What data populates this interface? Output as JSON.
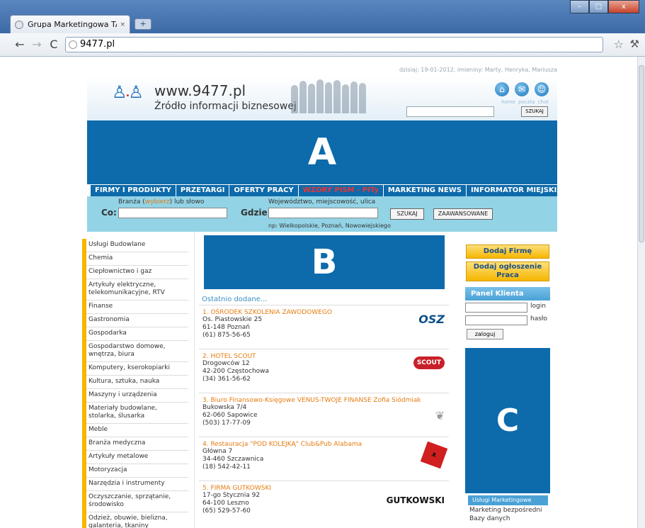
{
  "browser": {
    "tab_title": "Grupa Marketingowa TAI - ...",
    "tab_close": "×",
    "new_tab": "+",
    "url": "9477.pl",
    "win_min": "–",
    "win_max": "□",
    "win_close": "x"
  },
  "header": {
    "date_line": "dzisiaj: 19-01-2012,  imieniny: Marty, Henryka, Mariusza",
    "site_url": "www.9477.pl",
    "tagline": "Źródło informacji biznesowej",
    "icon_labels": "home poczta chat",
    "search_button": "SZUKAJ"
  },
  "banners": {
    "a": "A",
    "b": "B",
    "c": "C"
  },
  "nav": [
    "FIRMY I PRODUKTY",
    "PRZETARGI",
    "OFERTY PRACY",
    "WZORY PISM - PITy",
    "MARKETING NEWS",
    "INFORMATOR MIEJSKI"
  ],
  "search": {
    "hint_pre": "Branża (",
    "hint_link": "wybierz",
    "hint_post": ") lub słowo",
    "co_label": "Co:",
    "gdzie_label": "Gdzie:",
    "gdzie_hint": "Województwo, miejscowość, ulica",
    "example": "np: Wielkopolskie, Poznań, Nowowiejskiego",
    "search_btn": "SZUKAJ",
    "advanced_btn": "ZAAWANSOWANE"
  },
  "categories": [
    "Usługi Budowlane",
    "Chemia",
    "Ciepłownictwo i gaz",
    "Artykuły elektryczne, telekomunikacyjne, RTV",
    "Finanse",
    "Gastronomia",
    "Gospodarka",
    "Gospodarstwo domowe, wnętrza, biura",
    "Komputery, kserokopiarki",
    "Kultura, sztuka, nauka",
    "Maszyny i urządzenia",
    "Materiały budowlane, stolarka, ślusarka",
    "Meble",
    "Branża medyczna",
    "Artykuły metalowe",
    "Motoryzacja",
    "Narzędzia i instrumenty",
    "Oczyszczanie, sprzątanie, środowisko",
    "Odzież, obuwie, bielizna, galanteria, tkaniny"
  ],
  "recent": {
    "title": "Ostatnio dodane...",
    "items": [
      {
        "name": "1. OŚRODEK SZKOLENIA ZAWODOWEGO",
        "street": "Os. Piastowskie 25",
        "city": "61-148 Poznań",
        "phone": "(61) 875-56-65",
        "logo": "OSZ"
      },
      {
        "name": "2. HOTEL SCOUT",
        "street": "Drogowców 12",
        "city": "42-200 Częstochowa",
        "phone": "(34) 361-56-62",
        "logo": "SCOUT"
      },
      {
        "name": "3. Biuro Finansowo-Księgowe VENUS-TWOJE FINANSE Zofia Siódmiak",
        "street": "Bukowska 7/4",
        "city": "62-060 Sapowice",
        "phone": "(503) 17-77-09",
        "logo": ""
      },
      {
        "name": "4. Restauracja \"POD KOLEJKĄ\" Club&Pub Alabama",
        "street": "Główna 7",
        "city": "34-460 Szczawnica",
        "phone": "(18) 542-42-11",
        "logo": ""
      },
      {
        "name": "5. FIRMA GUTKOWSKI",
        "street": "17-go Stycznia 92",
        "city": "64-100 Leszno",
        "phone": "(65) 529-57-60",
        "logo": "GUTKOWSKI"
      }
    ]
  },
  "right": {
    "add_company": "Dodaj Firmę",
    "add_job": "Dodaj ogłoszenie Praca",
    "panel_title": "Panel Klienta",
    "login_label": "login",
    "password_label": "hasło",
    "login_btn": "zaloguj",
    "marketing_title": "Usługi Marketingowe",
    "links": [
      "Marketing bezpośredni",
      "Bazy danych"
    ]
  }
}
